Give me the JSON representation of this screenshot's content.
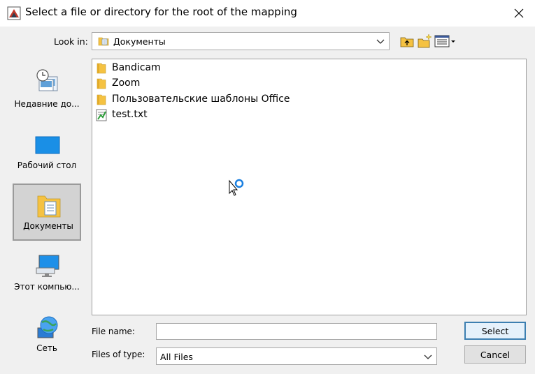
{
  "window": {
    "title": "Select a file or directory for the root of the mapping"
  },
  "lookin": {
    "label": "Look in:",
    "value": "Документы"
  },
  "places": [
    {
      "label": "Недавние до...",
      "icon": "recent-items-icon"
    },
    {
      "label": "Рабочий стол",
      "icon": "desktop-icon"
    },
    {
      "label": "Документы",
      "icon": "documents-folder-icon"
    },
    {
      "label": "Этот компью...",
      "icon": "computer-icon"
    },
    {
      "label": "Сеть",
      "icon": "network-icon"
    }
  ],
  "files": [
    {
      "name": "Bandicam",
      "icon": "folder-icon"
    },
    {
      "name": "Zoom",
      "icon": "folder-icon"
    },
    {
      "name": "Пользовательские шаблоны Office",
      "icon": "folder-icon"
    },
    {
      "name": "test.txt",
      "icon": "text-file-icon"
    }
  ],
  "filename": {
    "label": "File name:",
    "value": ""
  },
  "filetype": {
    "label": "Files of type:",
    "value": "All Files"
  },
  "buttons": {
    "select": "Select",
    "cancel": "Cancel"
  },
  "colors": {
    "accent": "#3c7fb1",
    "folder": "#f5c242",
    "selection": "#d3d3d3"
  }
}
